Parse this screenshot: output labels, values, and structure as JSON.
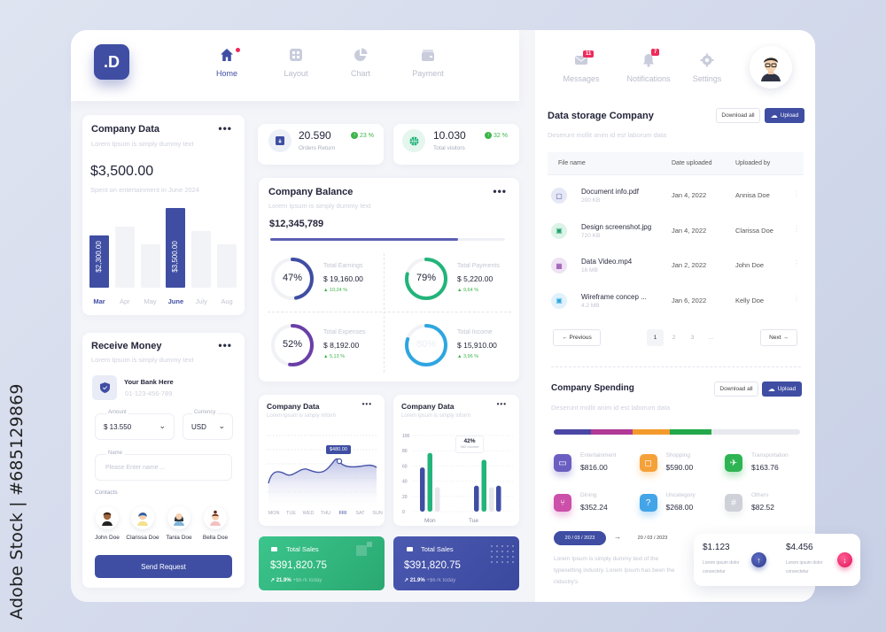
{
  "watermark": "Adobe Stock | #685129869",
  "logo": ".D",
  "nav": [
    {
      "label": "Home",
      "icon": "home-icon",
      "active": true
    },
    {
      "label": "Layout",
      "icon": "grid-icon"
    },
    {
      "label": "Chart",
      "icon": "pie-chart-icon"
    },
    {
      "label": "Payment",
      "icon": "wallet-icon"
    }
  ],
  "top_right": {
    "messages": {
      "label": "Messages",
      "badge": "11"
    },
    "notifications": {
      "label": "Notifications",
      "badge": "7"
    },
    "settings": {
      "label": "Settings"
    }
  },
  "company_data": {
    "title": "Company Data",
    "subtitle": "Lorem Ipsum is simply dummy text",
    "amount": "$3,500.00",
    "caption": "Spent on entertainment in June 2024",
    "bars": [
      {
        "month": "Mar",
        "value": 2300,
        "label": "$2,300.00",
        "highlight": true
      },
      {
        "month": "Apr",
        "value": 2700,
        "highlight": false
      },
      {
        "month": "May",
        "value": 1900,
        "highlight": false
      },
      {
        "month": "June",
        "value": 3500,
        "label": "$3,500.00",
        "highlight": true
      },
      {
        "month": "July",
        "value": 2500,
        "highlight": false
      },
      {
        "month": "Aug",
        "value": 1900,
        "highlight": false
      }
    ]
  },
  "stats": [
    {
      "value": "20.590",
      "label": "Orders Return",
      "change": "23 %"
    },
    {
      "value": "10.030",
      "label": "Total visitors",
      "change": "32 %"
    }
  ],
  "balance": {
    "title": "Company Balance",
    "subtitle": "Lorem Ipsum is simply dummy text",
    "amount": "$12,345,789",
    "progress": 0.8,
    "rings": [
      {
        "percent": 47,
        "label": "Total Earnings",
        "amount": "$ 19,160.00",
        "change": "10,24 %",
        "color": "#3f4ea3"
      },
      {
        "percent": 79,
        "label": "Total Payments",
        "amount": "$ 5,220.00",
        "change": "9,64 %",
        "color": "#22b47a"
      },
      {
        "percent": 52,
        "label": "Total Expenses",
        "amount": "$ 8,192.00",
        "change": "5,13 %",
        "color": "#6a3fa8"
      },
      {
        "percent": 80,
        "label": "Total Income",
        "amount": "$ 15,910.00",
        "change": "3,96 %",
        "color": "#2ea6e0"
      }
    ]
  },
  "receive": {
    "title": "Receive Money",
    "subtitle": "Lorem Ipsum is simply dummy text",
    "bank_name": "Your Bank Here",
    "bank_number": "01-123-456-789",
    "amount_label": "Amount",
    "amount_value": "$  13.550",
    "currency_label": "Currency",
    "currency_value": "USD",
    "name_label": "Name",
    "name_placeholder": "Please Enter name ...",
    "contacts_label": "Contacts",
    "contacts": [
      "John Doe",
      "Clarissa Doe",
      "Tania Doe",
      "Bella Doe"
    ],
    "send_label": "Send Request"
  },
  "line_card": {
    "title": "Company Data",
    "subtitle": "Lorem Ipsum is simply inform",
    "tooltip": "$480.00",
    "days": [
      "MON",
      "TUE",
      "WED",
      "THU",
      "FRI",
      "SAT",
      "SUN"
    ],
    "active_day": "FRI"
  },
  "bar_card": {
    "title": "Company Data",
    "subtitle": "Lorem Ipsum is simply inform",
    "yticks": [
      "100",
      "80",
      "60",
      "40",
      "20",
      "0"
    ],
    "tooltip_value": "42%",
    "tooltip_label": "982 Income",
    "groups": [
      {
        "label": "Mon",
        "values": [
          58,
          77,
          32
        ]
      },
      {
        "label": "Tue",
        "values": [
          34,
          68,
          32,
          34
        ]
      }
    ]
  },
  "sales": [
    {
      "title": "Total Sales",
      "amount": "$391,820.75",
      "change": "21.9%",
      "note": "+$67k today",
      "color": "green"
    },
    {
      "title": "Total Sales",
      "amount": "$391,820.75",
      "change": "21.9%",
      "note": "+$67k today",
      "color": "blue"
    }
  ],
  "storage": {
    "title": "Data storage Company",
    "subtitle": "Deserunt mollit anim id est laborum data",
    "download_label": "Download all",
    "upload_label": "Upload",
    "columns": [
      "File name",
      "Date uploaded",
      "Uploaded by"
    ],
    "files": [
      {
        "name": "Document info.pdf",
        "size": "200 KB",
        "date": "Jan 4, 2022",
        "by": "Annisa Doe",
        "icon": "document-icon",
        "color": "#e6e8f6",
        "fg": "#3f4ea3"
      },
      {
        "name": "Design screenshot.jpg",
        "size": "720 KB",
        "date": "Jan 4, 2022",
        "by": "Clarissa Doe",
        "icon": "image-icon",
        "color": "#dcf3e8",
        "fg": "#22a06b"
      },
      {
        "name": "Data Video.mp4",
        "size": "16 MB",
        "date": "Jan 2, 2022",
        "by": "John Doe",
        "icon": "video-icon",
        "color": "#efe2f3",
        "fg": "#8a3fa8"
      },
      {
        "name": "Wireframe concep ...",
        "size": "4.2 MB",
        "date": "Jan 6, 2022",
        "by": "Kelly Doe",
        "icon": "image-icon",
        "color": "#e1f2fb",
        "fg": "#2ea6e0"
      }
    ],
    "pagination": {
      "prev": "Previous",
      "next": "Next",
      "pages": [
        "1",
        "2",
        "3",
        "..."
      ],
      "current": "1"
    }
  },
  "spending": {
    "title": "Company Spending",
    "subtitle": "Deserunt mollit anim id est laborum data",
    "download_label": "Download all",
    "upload_label": "Upload",
    "segments": [
      {
        "share": 0.15,
        "color": "#4b47a5"
      },
      {
        "share": 0.17,
        "color": "#b03a96"
      },
      {
        "share": 0.15,
        "color": "#f39a2c"
      },
      {
        "share": 0.17,
        "color": "#22a84a"
      }
    ],
    "categories": [
      {
        "label": "Entertainment",
        "amount": "$816.00",
        "color": "#6a5fc1",
        "icon": "ticket-icon",
        "glyph": "▭"
      },
      {
        "label": "Shopping",
        "amount": "$590.00",
        "color": "#f5a13a",
        "icon": "shopping-bag-icon",
        "glyph": "◻"
      },
      {
        "label": "Transportation",
        "amount": "$163.76",
        "color": "#2eb452",
        "icon": "airplane-icon",
        "glyph": "✈"
      },
      {
        "label": "Dining",
        "amount": "$352.24",
        "color": "#cc4fa9",
        "icon": "dining-icon",
        "glyph": "⑂"
      },
      {
        "label": "Uncategory",
        "amount": "$268.00",
        "color": "#43a4e8",
        "icon": "question-icon",
        "glyph": "?"
      },
      {
        "label": "Others",
        "amount": "$82.52",
        "color": "#cfd1d8",
        "icon": "hash-icon",
        "glyph": "#"
      }
    ],
    "date_from": "20 / 03 / 2023",
    "date_to": "20 / 03 / 2023",
    "description": "Lorem Ipsum is simply dummy text of the typesetting industry. Lorem Ipsum has been the industry's"
  },
  "summary": [
    {
      "amount": "$1.123",
      "text": "Lorem ipsum dolor consectetur",
      "direction": "up"
    },
    {
      "amount": "$4.456",
      "text": "Lorem ipsum dolor consectetur",
      "direction": "down"
    }
  ]
}
